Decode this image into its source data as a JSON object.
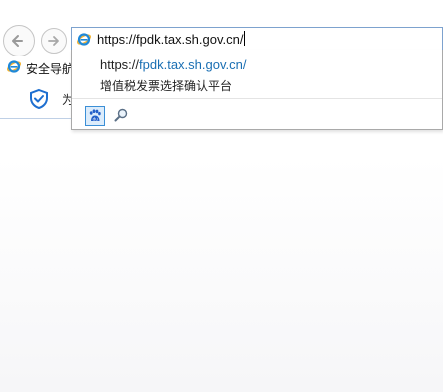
{
  "address_bar": {
    "url": "https://fpdk.tax.sh.gov.cn/"
  },
  "favorites_bar": {
    "items": [
      {
        "label": "安全导航"
      }
    ]
  },
  "tab": {
    "partial_title": "为"
  },
  "suggestions": {
    "url_prefix": "https://",
    "url_host": "fpdk.tax.sh.gov.cn/",
    "title": "增值税发票选择确认平台"
  },
  "icons": {
    "back": "back-arrow-icon",
    "forward": "forward-arrow-icon",
    "site": "ie-logo-icon",
    "shield": "shield-icon",
    "baidu": "baidu-paw-icon",
    "search": "magnifier-icon"
  },
  "colors": {
    "address_border": "#7da2ce",
    "link_blue": "#1a6fb3",
    "ie_blue": "#1e88d8",
    "ie_ring": "#f2b230"
  }
}
